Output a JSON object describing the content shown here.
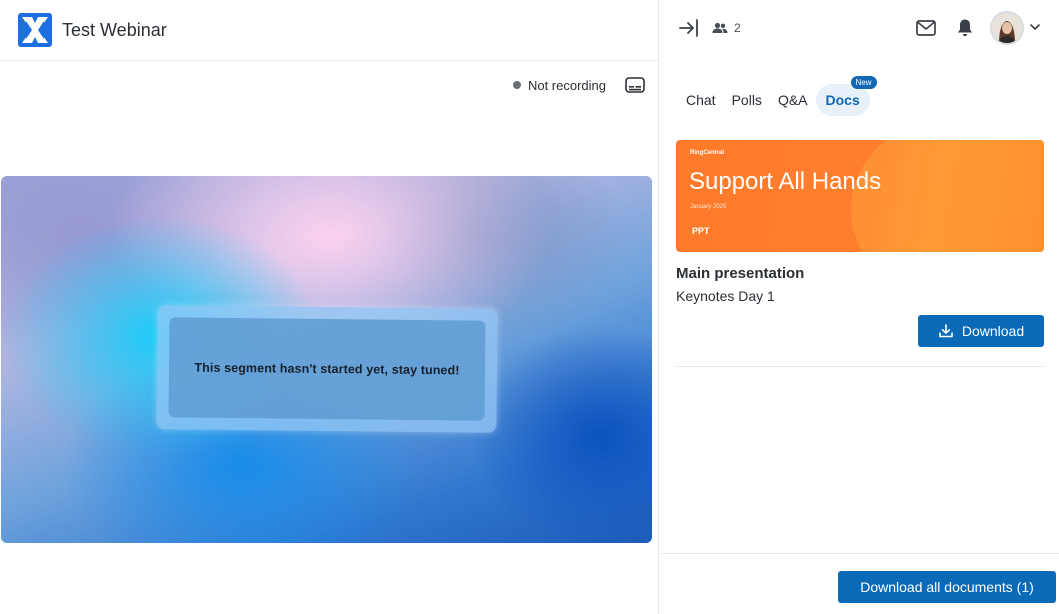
{
  "header": {
    "app_title": "Test Webinar",
    "logo_icon": "webinar-logo-icon"
  },
  "recording": {
    "status": "Not recording",
    "captions_icon": "closed-captions-icon"
  },
  "stage": {
    "message": "This segment hasn't started yet, stay tuned!"
  },
  "right_header": {
    "collapse_icon": "collapse-panel-icon",
    "participants_icon": "people-icon",
    "participants_count": "2",
    "mail_icon": "envelope-icon",
    "bell_icon": "bell-icon",
    "avatar": "user-avatar",
    "menu_icon": "chevron-down-icon"
  },
  "tabs": [
    {
      "label": "Chat",
      "active": false
    },
    {
      "label": "Polls",
      "active": false
    },
    {
      "label": "Q&A",
      "active": false
    },
    {
      "label": "Docs",
      "active": true,
      "badge": "New"
    }
  ],
  "doc": {
    "thumb_brand": "RingCentral",
    "thumb_title": "Support All Hands",
    "thumb_date": "January 2025",
    "thumb_type": "PPT",
    "title": "Main presentation",
    "subtitle": "Keynotes Day 1",
    "download_label": "Download"
  },
  "footer": {
    "download_all_label": "Download all documents (1)"
  },
  "colors": {
    "accent": "#0a6ab8",
    "tab_active_bg": "#e8f1fa",
    "thumb_orange": "#ff7a2a"
  }
}
